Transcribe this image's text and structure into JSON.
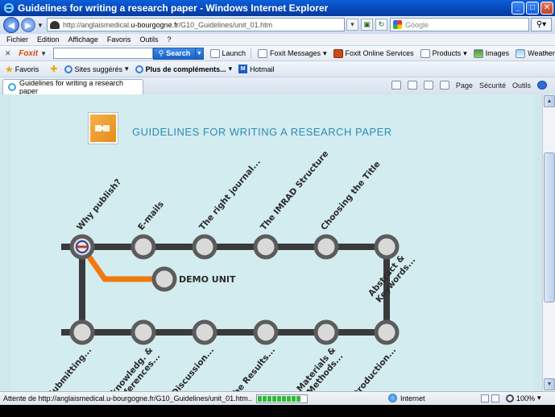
{
  "window": {
    "title": "Guidelines for writing a research paper - Windows Internet Explorer",
    "controls": {
      "minimize": "_",
      "maximize": "□",
      "close": "✕"
    }
  },
  "address_bar": {
    "url_prefix": "http://anglaismedical.",
    "url_host": "u-bourgogne.fr",
    "url_path": "/G10_Guidelines/unit_01.htm",
    "search_placeholder": "Google"
  },
  "menu": [
    "Fichier",
    "Edition",
    "Affichage",
    "Favoris",
    "Outils",
    "?"
  ],
  "foxit_toolbar": {
    "brand": "Foxit",
    "search_label": "Search",
    "items": [
      {
        "label": "Launch",
        "icon": "launch-icon"
      },
      {
        "label": "Foxit Messages",
        "icon": "messages-icon",
        "dropdown": true
      },
      {
        "label": "Foxit Online Services",
        "icon": "foxit-services-icon"
      },
      {
        "label": "Products",
        "icon": "products-icon",
        "dropdown": true
      },
      {
        "label": "Images",
        "icon": "images-icon"
      },
      {
        "label": "Weather",
        "icon": "weather-icon"
      }
    ]
  },
  "favorites_bar": {
    "favorites_label": "Favoris",
    "items": [
      {
        "label": "Sites suggérés",
        "dropdown": true,
        "bold": false
      },
      {
        "label": "Plus de compléments...",
        "dropdown": true,
        "bold": true
      },
      {
        "label": "Hotmail",
        "dropdown": false,
        "bold": false
      }
    ]
  },
  "tab": {
    "title": "Guidelines for writing a research paper"
  },
  "command_bar": {
    "page": "Page",
    "security": "Sécurité",
    "tools": "Outils"
  },
  "page": {
    "title": "GUIDELINES FOR WRITING A RESEARCH PAPER",
    "demo_label": "DEMO UNIT",
    "top_stations": [
      "Why publish?",
      "E-mails",
      "The right journal...",
      "The IMRAD Structure",
      "Choosing the Title"
    ],
    "right_station": "Abstract & Keywords...",
    "bottom_stations": [
      "Submitting...",
      "Acknowledg. & References...",
      "Discussion...",
      "The Results...",
      "Materials & Methods...",
      "Introduction..."
    ],
    "colors": {
      "track": "#3a3a3a",
      "station_ring": "#5c5c5c",
      "station_fill": "#d9d9d9",
      "branch": "#f07a10",
      "title": "#2c8cb6",
      "background": "#d3ecef"
    }
  },
  "status_bar": {
    "text": "Attente de http://anglaismedical.u-bourgogne.fr/G10_Guidelines/unit_01.htm...",
    "zone": "Internet",
    "zoom": "100%",
    "progress": 0.9
  }
}
